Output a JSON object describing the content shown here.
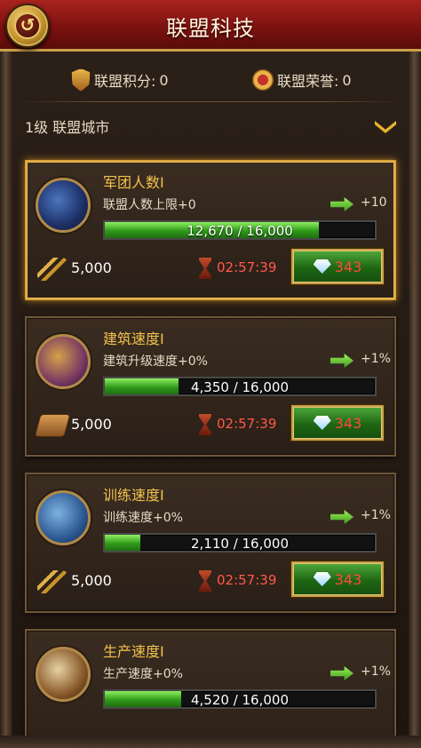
{
  "header": {
    "title": "联盟科技",
    "back_glyph": "↺"
  },
  "stats": {
    "points_label": "联盟积分:",
    "points_value": "0",
    "honor_label": "联盟荣誉:",
    "honor_value": "0"
  },
  "section": {
    "title": "1级 联盟城市"
  },
  "techs": [
    {
      "name": "军团人数I",
      "desc": "联盟人数上限+0",
      "bonus": "+10",
      "progress_text": "12,670 / 16,000",
      "progress_fraction": 0.792,
      "cost": "5,000",
      "cost_icon": "wheat-icon",
      "timer": "02:57:39",
      "gems": "343"
    },
    {
      "name": "建筑速度I",
      "desc": "建筑升级速度+0%",
      "bonus": "+1%",
      "progress_text": "4,350 / 16,000",
      "progress_fraction": 0.272,
      "cost": "5,000",
      "cost_icon": "wood-icon",
      "timer": "02:57:39",
      "gems": "343"
    },
    {
      "name": "训练速度I",
      "desc": "训练速度+0%",
      "bonus": "+1%",
      "progress_text": "2,110 / 16,000",
      "progress_fraction": 0.132,
      "cost": "5,000",
      "cost_icon": "wheat-icon",
      "timer": "02:57:39",
      "gems": "343"
    },
    {
      "name": "生产速度I",
      "desc": "生产速度+0%",
      "bonus": "+1%",
      "progress_text": "4,520 / 16,000",
      "progress_fraction": 0.283
    }
  ],
  "colors": {
    "accent_gold": "#f2c24c",
    "timer_red": "#ff5a4a",
    "progress_green": "#2f9a1a"
  }
}
